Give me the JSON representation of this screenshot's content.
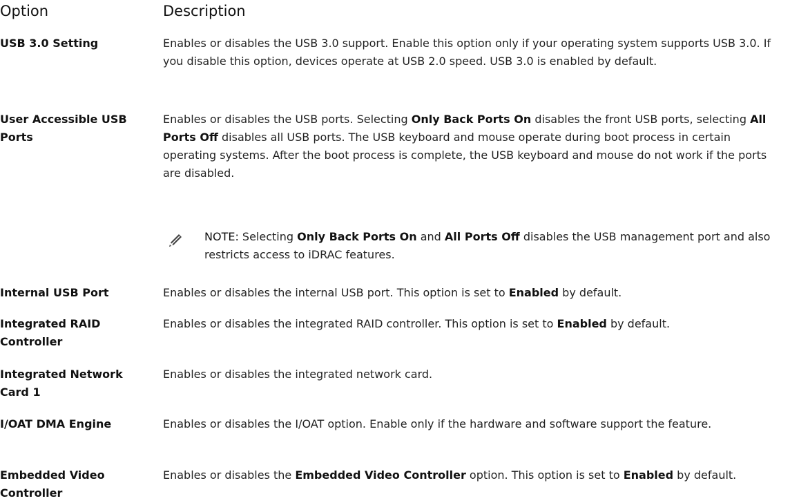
{
  "header": {
    "option": "Option",
    "description": "Description"
  },
  "rows": [
    {
      "option": "USB 3.0 Setting",
      "description": [
        "Enables or disables the USB 3.0 support. Enable this option only if your operating system supports USB 3.0. If you disable this option, devices operate at USB 2.0 speed. USB 3.0 is enabled by default."
      ]
    },
    {
      "option": "User Accessible USB Ports",
      "description": [
        "Enables or disables the USB ports. Selecting ",
        "Only Back Ports On",
        " disables the front USB ports, selecting ",
        "All Ports Off",
        " disables all USB ports. The USB keyboard and mouse operate during boot process in certain operating systems. After the boot process is complete, the USB keyboard and mouse do not work if the ports are disabled."
      ],
      "note": {
        "icon": "note-pencil-icon",
        "label": "NOTE:",
        "parts": [
          " Selecting ",
          "Only Back Ports On",
          " and ",
          "All Ports Off",
          " disables the USB management port and also restricts access to iDRAC features."
        ]
      }
    },
    {
      "option": "Internal USB Port",
      "description": [
        "Enables or disables the internal USB port. This option is set to ",
        "Enabled",
        " by default."
      ]
    },
    {
      "option": "Integrated RAID Controller",
      "description": [
        "Enables or disables the integrated RAID controller. This option is set to ",
        "Enabled",
        " by default."
      ]
    },
    {
      "option": "Integrated Network Card 1",
      "description": [
        "Enables or disables the integrated network card."
      ]
    },
    {
      "option": "I/OAT DMA Engine",
      "description": [
        "Enables or disables the I/OAT option. Enable only if the hardware and software support the feature."
      ]
    },
    {
      "option": "Embedded Video Controller",
      "description": [
        "Enables or disables the ",
        "Embedded Video Controller",
        " option. This option is set to ",
        "Enabled",
        " by default."
      ]
    }
  ]
}
